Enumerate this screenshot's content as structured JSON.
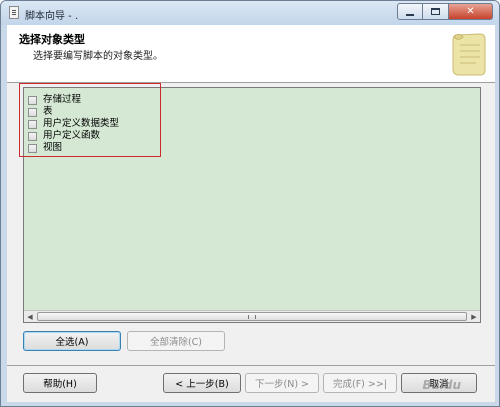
{
  "window": {
    "title": "脚本向导 - ."
  },
  "header": {
    "title": "选择对象类型",
    "subtitle": "选择要编写脚本的对象类型。"
  },
  "object_types": [
    {
      "label": "存储过程",
      "checked": false
    },
    {
      "label": "表",
      "checked": false
    },
    {
      "label": "用户定义数据类型",
      "checked": false
    },
    {
      "label": "用户定义函数",
      "checked": false
    },
    {
      "label": "视图",
      "checked": false
    }
  ],
  "selection_buttons": {
    "select_all": "全选(A)",
    "clear_all": "全部清除(C)"
  },
  "footer": {
    "help": "帮助(H)",
    "back": "< 上一步(B)",
    "next": "下一步(N) >",
    "finish": "完成(F) >>|",
    "cancel": "取消"
  },
  "watermark": "Baidu"
}
